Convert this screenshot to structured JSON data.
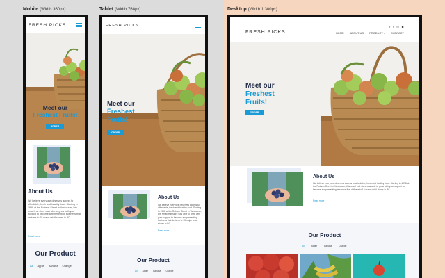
{
  "labels": {
    "mobile": "Mobile",
    "mobile_width": "(Width 360px)",
    "tablet": "Tablet",
    "tablet_width": "(Width 768px)",
    "desktop": "Desktop",
    "desktop_width": "(Width 1,300px)"
  },
  "site": {
    "logo": "FRESH PICKS",
    "hero_line1": "Meet our",
    "hero_line2": "Freshest",
    "hero_line3": "Fruits!",
    "hero_mobile_line2": "Freshest Fruits!",
    "order_button": "ORDER",
    "about_heading": "About Us",
    "about_text_mobile": "We believe everyone deserves access to affordable, fresh and healthy food. Starting in 1998 at the Robson Street in Vancouver, this small fruit store was able to grow with your support to become a representing business that delivers to 15 major retail stores in BC.",
    "about_text_short": "We believe everyone deserves access to affordable, fresh and healthy food. Starting in 1998 at the Robson Street in Vancouver, this small fruit store was able to grow with your support to become a representing business that delivers to 15 major retail stores in BC.",
    "read_more": "Read more",
    "product_heading": "Our Product",
    "filters": [
      "All",
      "Apple",
      "Banana",
      "Orange"
    ],
    "desktop_nav": [
      "HOME",
      "ABOUT US",
      "PRODUCT",
      "CONTACT"
    ],
    "product_dropdown_icon": "chevron-down-icon",
    "social_icons": [
      "facebook-icon",
      "twitter-icon",
      "instagram-icon",
      "youtube-icon"
    ]
  },
  "colors": {
    "accent": "#1a9bd6",
    "heading": "#1f2a44",
    "desktop_bg": "#f7d6bf"
  }
}
